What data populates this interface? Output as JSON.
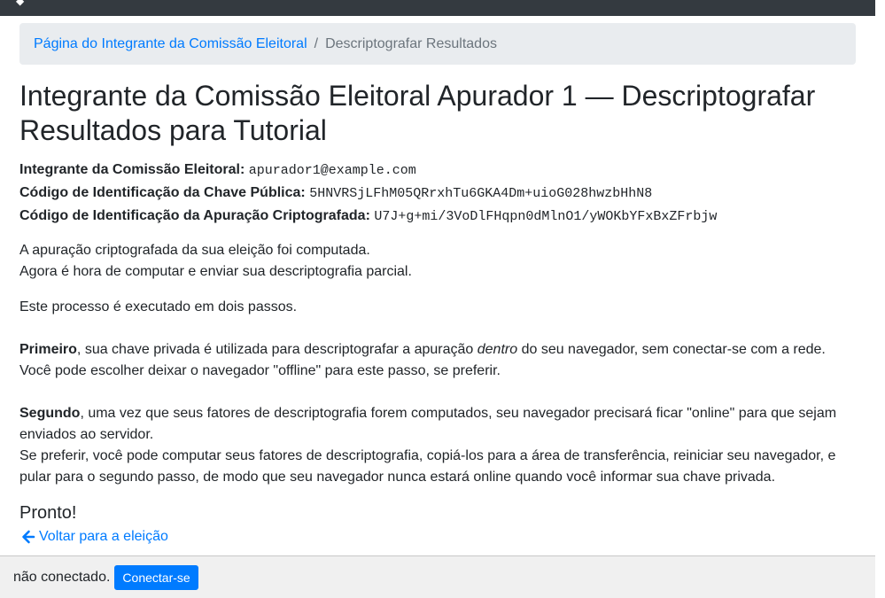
{
  "breadcrumb": {
    "link_label": "Página do Integrante da Comissão Eleitoral",
    "separator": "/",
    "current": "Descriptografar Resultados"
  },
  "page": {
    "title": "Integrante da Comissão Eleitoral Apurador 1 — Descriptografar Resultados para Tutorial"
  },
  "info": {
    "member_label": "Integrante da Comissão Eleitoral:",
    "member_value": "apurador1@example.com",
    "key_label": "Código de Identificação da Chave Pública:",
    "key_value": "5HNVRSjLFhM05QRrxhTu6GKA4Dm+uioG028hwzbHhN8",
    "tally_label": "Código de Identificação da Apuração Criptografada:",
    "tally_value": "U7J+g+mi/3VoDlFHqpn0dMlnO1/yWOKbYFxBxZFrbjw"
  },
  "body": {
    "intro_line1": "A apuração criptografada da sua eleição foi computada.",
    "intro_line2": "Agora é hora de computar e enviar sua descriptografia parcial.",
    "steps_intro": "Este processo é executado em dois passos.",
    "first_bold": "Primeiro",
    "first_text_a": ", sua chave privada é utilizada para descriptografar a apuração ",
    "first_italic": "dentro",
    "first_text_b": " do seu navegador, sem conectar-se com a rede.",
    "first_line2": "Você pode escolher deixar o navegador \"offline\" para este passo, se preferir.",
    "second_bold": "Segundo",
    "second_text": ", uma vez que seus fatores de descriptografia forem computados, seu navegador precisará ficar \"online\" para que sejam enviados ao servidor.",
    "second_line2": "Se preferir, você pode computar seus fatores de descriptografia, copiá-los para a área de transferência, reiniciar seu navegador, e pular para o segundo passo, de modo que seu navegador nunca estará online quando você informar sua chave privada."
  },
  "ready": {
    "heading": "Pronto!",
    "back_label": "Voltar para a eleição"
  },
  "footer": {
    "status": "não conectado.",
    "connect_label": "Conectar-se"
  },
  "colors": {
    "link": "#007bff",
    "button_bg": "#007bff",
    "topbar": "#343a40",
    "breadcrumb_bg": "#e9ecef"
  }
}
